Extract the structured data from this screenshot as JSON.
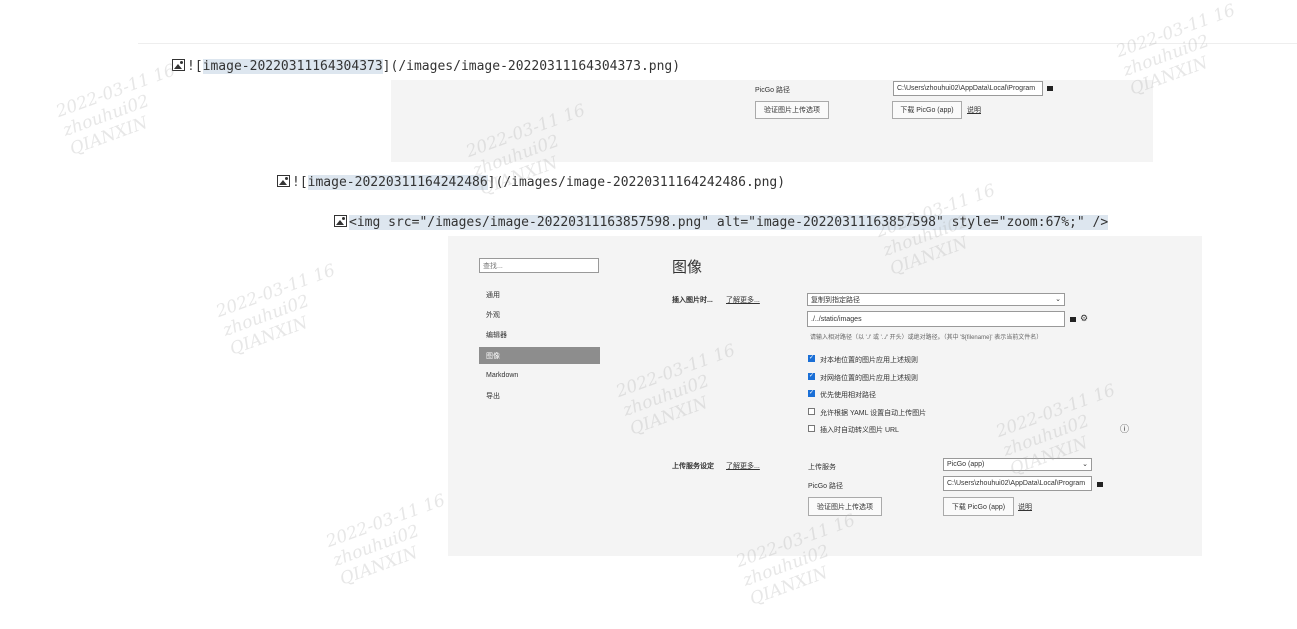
{
  "lines": {
    "line1_prefix": "![",
    "line1_alt": "image-20220311164304373",
    "line1_suffix": "](/images/image-20220311164304373.png)",
    "line2_prefix": "![",
    "line2_alt": "image-20220311164242486",
    "line2_suffix": "](/images/image-20220311164242486.png)",
    "line3_code": "<img src=\"/images/image-20220311163857598.png\" alt=\"image-20220311163857598\" style=\"zoom:67%;\" />"
  },
  "top_panel": {
    "picgo_label": "PicGo 路径",
    "picgo_path": "C:\\Users\\zhouhui02\\AppData\\Local\\Program",
    "verify_button": "验证图片上传选项",
    "download_button": "下载 PicGo (app)",
    "help_link": "说明"
  },
  "settings": {
    "search_placeholder": "查找...",
    "sidebar": [
      "通用",
      "外观",
      "编辑器",
      "图像",
      "Markdown",
      "导出"
    ],
    "active_index": 3,
    "title": "图像",
    "insert_label": "插入图片时...",
    "learn_more": "了解更多...",
    "insert_select": "复制到指定路径",
    "path_value": "./../static/images",
    "path_hint": "请输入相对路径（以 './' 或 '../' 开头）或绝对路径。（其中 '${filename}' 表示当前文件名）",
    "checkboxes": [
      {
        "label": "对本地位置的图片应用上述规则",
        "checked": true
      },
      {
        "label": "对网络位置的图片应用上述规则",
        "checked": true
      },
      {
        "label": "优先使用相对路径",
        "checked": true
      },
      {
        "label": "允许根据 YAML 设置自动上传图片",
        "checked": false
      },
      {
        "label": "插入时自动转义图片 URL",
        "checked": false
      }
    ],
    "upload_label": "上传服务设定",
    "upload_learn_more": "了解更多...",
    "service_label": "上传服务",
    "service_value": "PicGo (app)",
    "picgo_label": "PicGo 路径",
    "picgo_path": "C:\\Users\\zhouhui02\\AppData\\Local\\Program",
    "verify_button": "验证图片上传选项",
    "download_button": "下载 PicGo (app)",
    "help_link": "说明",
    "info_icon_text": "ⓘ"
  },
  "watermark": {
    "date": "2022-03-11 16",
    "user": "zhouhui02",
    "org": "QIANXIN"
  },
  "icons": {
    "image": "image-icon",
    "folder": "folder-icon",
    "gear": "gear-icon",
    "info": "info-icon"
  }
}
